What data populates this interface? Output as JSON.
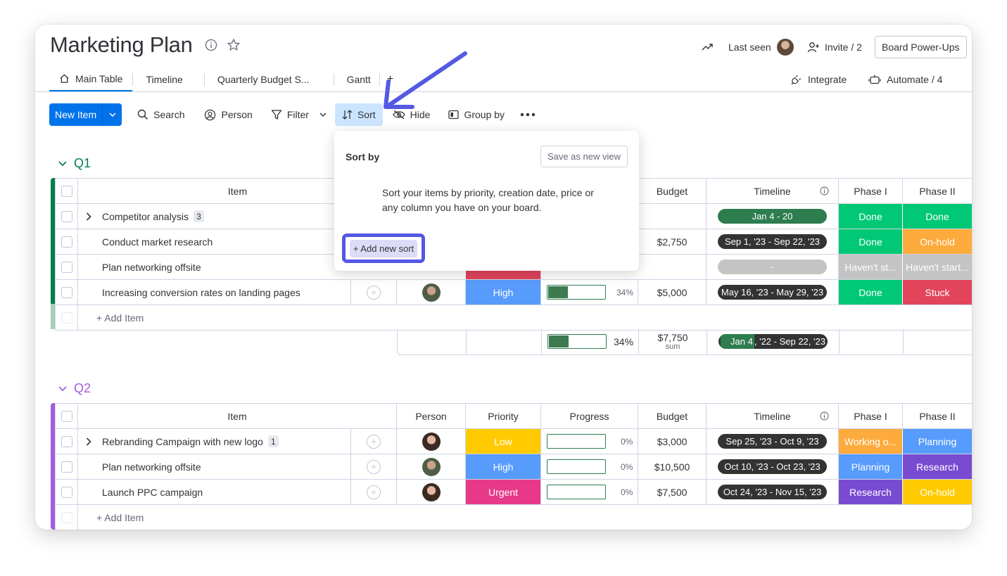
{
  "board": {
    "title": "Marketing Plan",
    "last_seen_label": "Last seen",
    "invite_label": "Invite / 2",
    "powerups_label": "Board Power-Ups"
  },
  "tabs": [
    {
      "label": "Main Table"
    },
    {
      "label": "Timeline"
    },
    {
      "label": "Quarterly Budget S..."
    },
    {
      "label": "Gantt"
    },
    {
      "label": "+"
    }
  ],
  "integrations": {
    "integrate_label": "Integrate",
    "automate_label": "Automate / 4"
  },
  "toolbar": {
    "new_item": "New Item",
    "search": "Search",
    "person": "Person",
    "filter": "Filter",
    "sort": "Sort",
    "hide": "Hide",
    "group_by": "Group by"
  },
  "sort_popup": {
    "title": "Sort by",
    "save_view": "Save as new view",
    "description_line1": "Sort your items by priority, creation date, price or",
    "description_line2": "any column you have on your board.",
    "add_sort": "+ Add new sort"
  },
  "columns": {
    "item": "Item",
    "person": "Person",
    "priority": "Priority",
    "progress": "Progress",
    "budget": "Budget",
    "timeline": "Timeline",
    "phase1": "Phase I",
    "phase2": "Phase II"
  },
  "groups": [
    {
      "name": "Q1",
      "color": "#037f4c",
      "rows": [
        {
          "item": "Competitor analysis",
          "subitems": "3",
          "budget": "",
          "timeline": "Jan 4 - 20",
          "phase1": "Done",
          "phase2": "Done"
        },
        {
          "item": "Conduct market research",
          "budget": "$2,750",
          "timeline": "Sep 1, '23 - Sep 22, '23",
          "phase1": "Done",
          "phase2": "On-hold"
        },
        {
          "item": "Plan networking offsite",
          "budget": "",
          "timeline": "-",
          "phase1": "Haven't st...",
          "phase2": "Haven't start..."
        },
        {
          "item": "Increasing conversion rates on landing pages",
          "priority": "High",
          "progress": "34%",
          "progress_value": 0.34,
          "budget": "$5,000",
          "timeline": "May 16, '23 - May 29, '23",
          "phase1": "Done",
          "phase2": "Stuck"
        }
      ],
      "add_item": "+ Add Item",
      "summary": {
        "progress": "34%",
        "progress_value": 0.34,
        "budget": "$7,750",
        "budget_note": "sum",
        "timeline_a": "Jan 4",
        "timeline_b": ", '22 - Sep 22, '23"
      }
    },
    {
      "name": "Q2",
      "color": "#a25ddc",
      "rows": [
        {
          "item": "Rebranding Campaign with new logo",
          "subitems": "1",
          "priority": "Low",
          "progress": "0%",
          "progress_value": 0,
          "budget": "$3,000",
          "timeline": "Sep 25, '23 - Oct 9, '23",
          "phase1": "Working o...",
          "phase2": "Planning"
        },
        {
          "item": "Plan networking offsite",
          "priority": "High",
          "progress": "0%",
          "progress_value": 0,
          "budget": "$10,500",
          "timeline": "Oct 10, '23 - Oct 23, '23",
          "phase1": "Planning",
          "phase2": "Research"
        },
        {
          "item": "Launch PPC campaign",
          "priority": "Urgent",
          "progress": "0%",
          "progress_value": 0,
          "budget": "$7,500",
          "timeline": "Oct 24, '23 - Nov 15, '23",
          "phase1": "Research",
          "phase2": "On-hold"
        }
      ],
      "add_item": "+ Add Item"
    }
  ],
  "colors": {
    "done": "#00c875",
    "onhold": "#fdab3d",
    "stuck": "#e2445c",
    "not_started": "#c4c4c4",
    "high": "#579bfc",
    "low": "#ffcb00",
    "urgent": "#e2445c",
    "planning": "#579bfc",
    "research": "#784bd1",
    "working": "#fdab3d",
    "annotation": "#5459e3"
  }
}
